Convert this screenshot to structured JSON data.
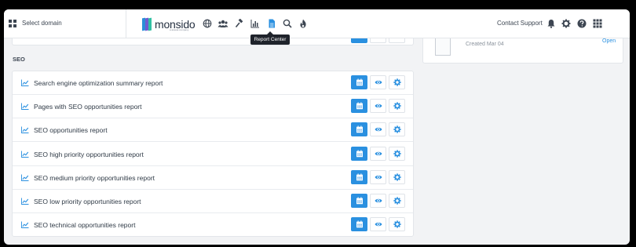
{
  "topbar": {
    "domain_label": "Select domain",
    "logo_text": "monsido",
    "logo_sub": "a acquia company",
    "contact_label": "Contact Support",
    "tooltip": "Report Center",
    "nav_icons": [
      "globe-icon",
      "users-icon",
      "gavel-icon",
      "chart-icon",
      "report-icon",
      "search-icon",
      "flame-icon"
    ],
    "right_icons": [
      "bell-icon",
      "gear-icon",
      "help-icon",
      "apps-icon"
    ]
  },
  "side": {
    "created": "Created Mar 04",
    "open_label": "Open"
  },
  "section": {
    "title": "SEO"
  },
  "reports": [
    {
      "label": "Search engine optimization summary report"
    },
    {
      "label": "Pages with SEO opportunities report"
    },
    {
      "label": "SEO opportunities report"
    },
    {
      "label": "SEO high priority opportunities report"
    },
    {
      "label": "SEO medium priority opportunities report"
    },
    {
      "label": "SEO low priority opportunities report"
    },
    {
      "label": "SEO technical opportunities report"
    }
  ],
  "colors": {
    "accent": "#2a90e0",
    "text": "#2f3a46",
    "background": "#f2f3f5"
  }
}
